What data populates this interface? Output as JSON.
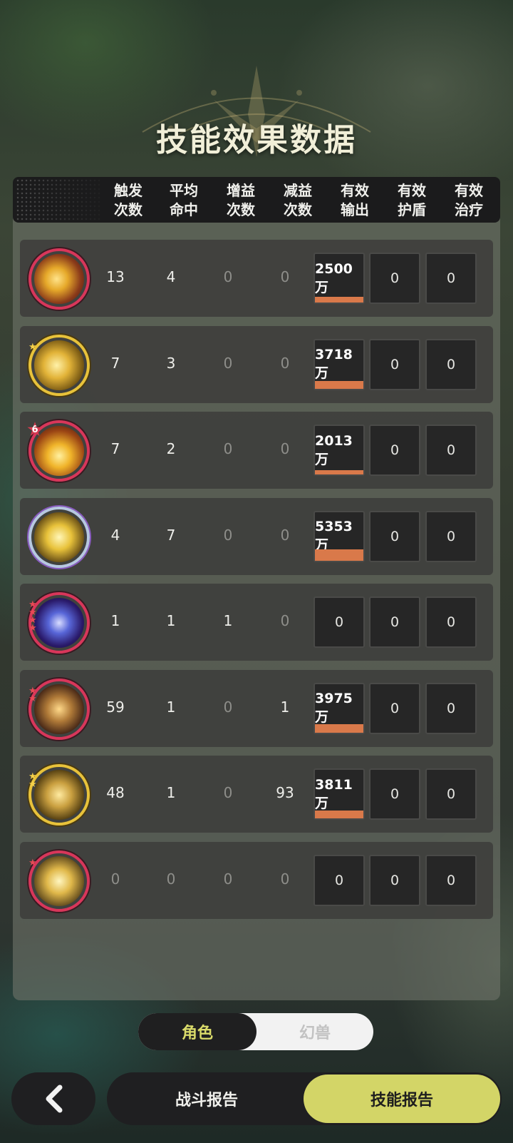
{
  "page": {
    "title": "技能效果数据"
  },
  "columns": [
    {
      "key": "trigger_count",
      "label_line1": "触发",
      "label_line2": "次数"
    },
    {
      "key": "avg_hits",
      "label_line1": "平均",
      "label_line2": "命中"
    },
    {
      "key": "buff_count",
      "label_line1": "增益",
      "label_line2": "次数"
    },
    {
      "key": "debuff_count",
      "label_line1": "减益",
      "label_line2": "次数"
    },
    {
      "key": "effective_output",
      "label_line1": "有效",
      "label_line2": "输出"
    },
    {
      "key": "effective_shield",
      "label_line1": "有效",
      "label_line2": "护盾"
    },
    {
      "key": "effective_heal",
      "label_line1": "有效",
      "label_line2": "治疗"
    }
  ],
  "rows": [
    {
      "icon": "lightning-burst-skill-icon",
      "ring": "red",
      "stars": 0,
      "badge": "",
      "trigger": "13",
      "avg_hits": "4",
      "buff": "0",
      "debuff": "0",
      "output": "2500万",
      "output_ratio": 0.47,
      "shield": "0",
      "heal": "0"
    },
    {
      "icon": "golden-sparks-skill-icon",
      "ring": "gold",
      "stars": 1,
      "badge": "",
      "trigger": "7",
      "avg_hits": "3",
      "buff": "0",
      "debuff": "0",
      "output": "3718万",
      "output_ratio": 0.69,
      "shield": "0",
      "heal": "0"
    },
    {
      "icon": "ground-strike-skill-icon",
      "ring": "red",
      "stars": 0,
      "badge": "6",
      "trigger": "7",
      "avg_hits": "2",
      "buff": "0",
      "debuff": "0",
      "output": "2013万",
      "output_ratio": 0.38,
      "shield": "0",
      "heal": "0"
    },
    {
      "icon": "thunder-orb-skill-icon",
      "ring": "violet",
      "stars": 0,
      "badge": "",
      "trigger": "4",
      "avg_hits": "7",
      "buff": "0",
      "debuff": "0",
      "output": "5353万",
      "output_ratio": 1.0,
      "shield": "0",
      "heal": "0"
    },
    {
      "icon": "arcane-clock-skill-icon",
      "ring": "red",
      "stars": 4,
      "badge": "",
      "trigger": "1",
      "avg_hits": "1",
      "buff": "1",
      "debuff": "0",
      "output": "0",
      "output_ratio": 0,
      "shield": "0",
      "heal": "0"
    },
    {
      "icon": "blade-slash-skill-icon",
      "ring": "red",
      "stars": 2,
      "badge": "",
      "trigger": "59",
      "avg_hits": "1",
      "buff": "0",
      "debuff": "1",
      "output": "3975万",
      "output_ratio": 0.74,
      "shield": "0",
      "heal": "0"
    },
    {
      "icon": "golden-circle-skill-icon",
      "ring": "gold",
      "stars": 2,
      "badge": "",
      "trigger": "48",
      "avg_hits": "1",
      "buff": "0",
      "debuff": "93",
      "output": "3811万",
      "output_ratio": 0.71,
      "shield": "0",
      "heal": "0"
    },
    {
      "icon": "summon-spirit-skill-icon",
      "ring": "red",
      "stars": 1,
      "badge": "",
      "trigger": "0",
      "avg_hits": "0",
      "buff": "0",
      "debuff": "0",
      "output": "0",
      "output_ratio": 0,
      "shield": "0",
      "heal": "0"
    }
  ],
  "toggle": {
    "active_label": "角色",
    "inactive_label": "幻兽"
  },
  "nav": {
    "back_icon": "chevron-left-icon",
    "battle_report": "战斗报告",
    "skill_report": "技能报告"
  },
  "colors": {
    "accent": "#d3d567",
    "damage_bar": "#d9794a",
    "ring_red": "#d8365a",
    "ring_gold": "#e8c23a"
  }
}
